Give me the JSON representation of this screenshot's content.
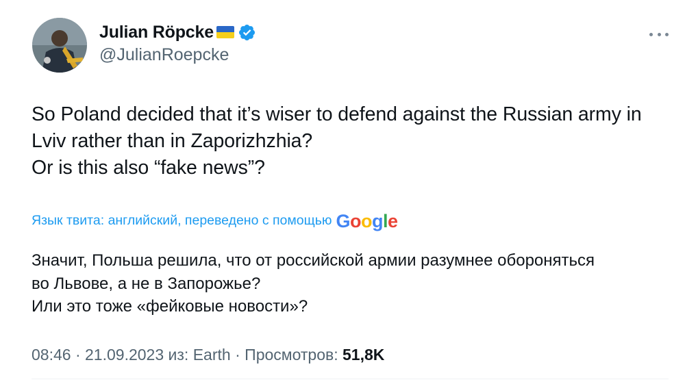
{
  "author": {
    "display_name": "Julian Röpcke",
    "handle": "@JulianRoepcke",
    "flag_icon": "ukraine-flag-icon",
    "verified_icon": "verified-badge-icon",
    "verified_color": "#1d9bf0"
  },
  "menu": {
    "icon": "more-options-icon"
  },
  "tweet": {
    "lines": [
      "So Poland decided that it’s wiser to defend against the Russian army in",
      "Lviv rather than in Zaporizhzhia?",
      "Or is this also “fake news”?"
    ]
  },
  "translation": {
    "label": "Язык твита: английский, переведено с помощью",
    "provider": "Google",
    "link_color": "#1d9bf0",
    "lines": [
      "Значит, Польша решила, что от российской армии разумнее обороняться",
      "во Львове, а не в Запорожье?",
      "Или это тоже «фейковые новости»?"
    ]
  },
  "meta": {
    "time": "08:46",
    "separator": " · ",
    "date": "21.09.2023",
    "source_prefix": "из:",
    "source": "Earth",
    "views_label": "Просмотров:",
    "views_count": "51,8K"
  }
}
